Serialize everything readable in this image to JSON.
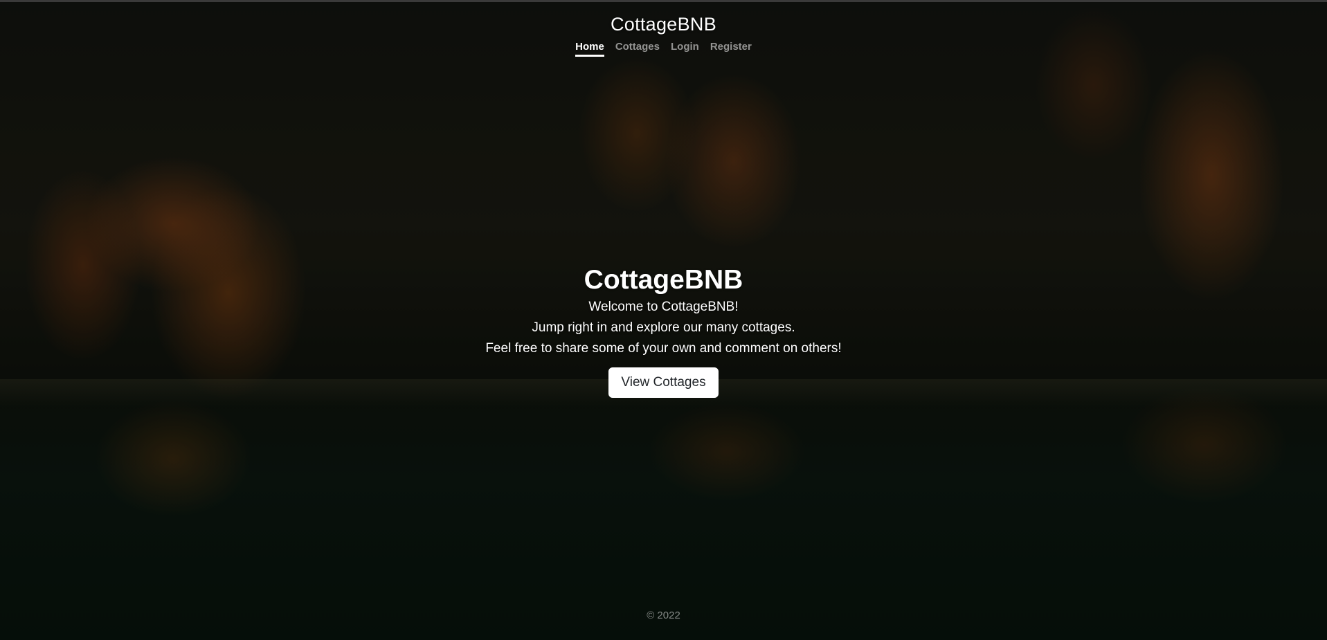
{
  "header": {
    "brand": "CottageBNB",
    "nav": [
      {
        "label": "Home",
        "active": true
      },
      {
        "label": "Cottages",
        "active": false
      },
      {
        "label": "Login",
        "active": false
      },
      {
        "label": "Register",
        "active": false
      }
    ]
  },
  "hero": {
    "title": "CottageBNB",
    "lines": [
      "Welcome to CottageBNB!",
      "Jump right in and explore our many cottages.",
      "Feel free to share some of your own and comment on others!"
    ],
    "cta_label": "View Cottages"
  },
  "footer": {
    "text": "© 2022"
  },
  "colors": {
    "button_bg": "#ffffff",
    "button_text": "#212529",
    "nav_inactive": "rgba(255,255,255,0.55)"
  }
}
